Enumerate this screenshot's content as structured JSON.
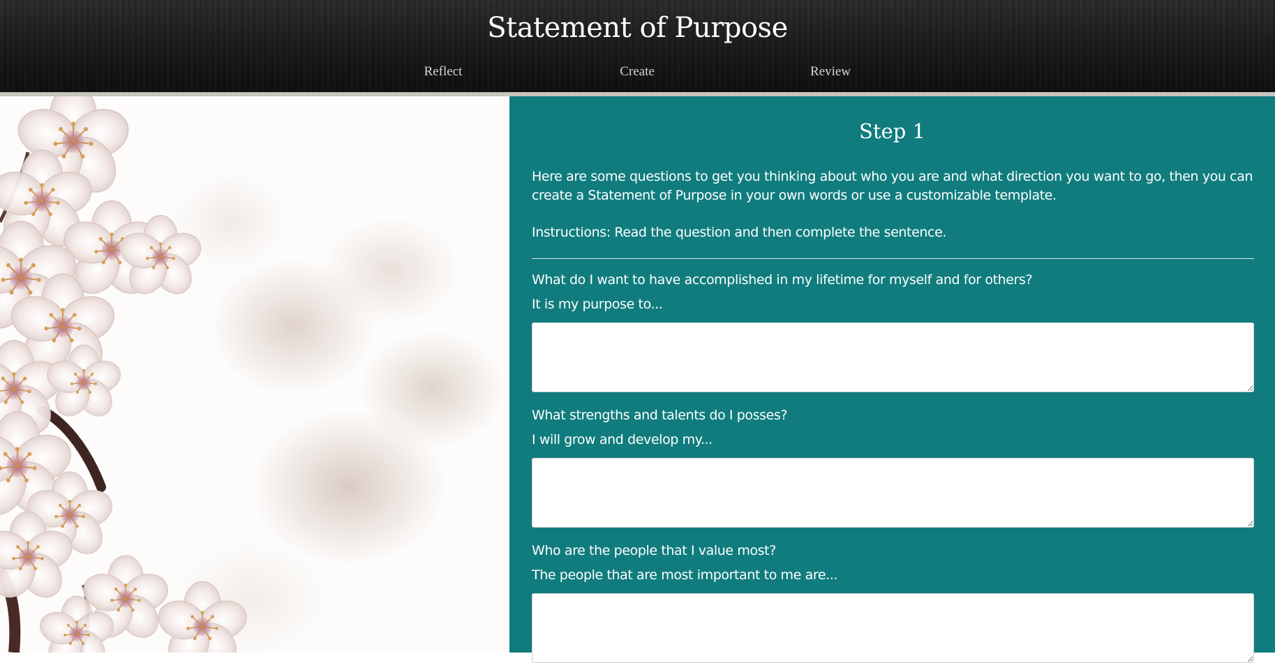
{
  "header": {
    "title": "Statement of Purpose",
    "nav": [
      {
        "label": "Reflect"
      },
      {
        "label": "Create"
      },
      {
        "label": "Review"
      }
    ]
  },
  "hero_image": {
    "subject": "cherry-blossom",
    "colors": {
      "petal": "#f1e4e1",
      "stamen": "#c9894a",
      "branch": "#4a2a26"
    }
  },
  "step": {
    "title": "Step 1",
    "intro": "Here are some questions to get you thinking about who you are and what direction you want to go, then you can create a Statement of Purpose in your own words or use a customizable template.",
    "instructions": "Instructions: Read the question and then complete the sentence.",
    "questions": [
      {
        "question": "What do I want to have accomplished in my lifetime for myself and for others?",
        "prompt": "It is my purpose to...",
        "value": ""
      },
      {
        "question": "What strengths and talents do I posses?",
        "prompt": "I will grow and develop my...",
        "value": ""
      },
      {
        "question": "Who are the people that I value most?",
        "prompt": "The people that are most important to me are...",
        "value": ""
      }
    ]
  },
  "colors": {
    "header_bg": "#141414",
    "panel_bg": "#107c7e",
    "text_light": "#ffffff",
    "nav_text": "#dcd4cf"
  }
}
